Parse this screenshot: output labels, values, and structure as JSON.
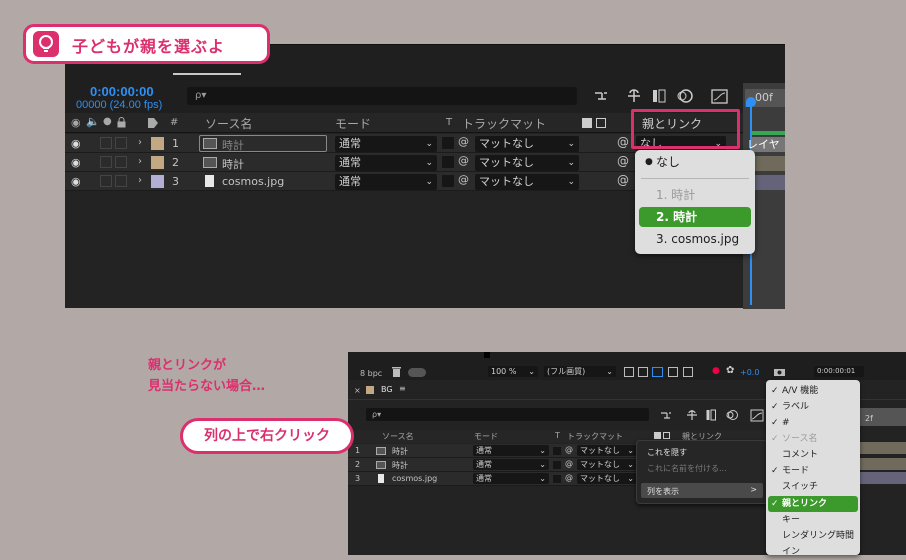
{
  "badge": {
    "title": "子どもが親を選ぶよ",
    "icon": "lightbulb-icon"
  },
  "top": {
    "timecode": "0:00:00:00",
    "fps": "00000 (24.00 fps)",
    "search_placeholder": "ρ▾",
    "timeline_label": "00f",
    "headers": {
      "hash": "#",
      "source": "ソース名",
      "mode": "モード",
      "t": "T",
      "matte": "トラックマット",
      "parent": "親とリンク"
    },
    "parent_value": "なし",
    "layer_label_right": "レイヤー",
    "rows": [
      {
        "num": "1",
        "name": "時計",
        "mode": "通常",
        "matte": "マットなし",
        "color": "#c2a983",
        "kind": "comp"
      },
      {
        "num": "2",
        "name": "時計",
        "mode": "通常",
        "matte": "マットなし",
        "color": "#c2a983",
        "kind": "comp"
      },
      {
        "num": "3",
        "name": "cosmos.jpg",
        "mode": "通常",
        "matte": "マットなし",
        "color": "#b3aed4",
        "kind": "file"
      }
    ],
    "dropdown": [
      {
        "label": "なし",
        "bullet": "●"
      },
      {
        "label": "1. 時計"
      },
      {
        "label": "2. 時計"
      },
      {
        "label": "3. cosmos.jpg"
      }
    ]
  },
  "notes": {
    "line1": "親とリンクが",
    "line2": "見当たらない場合…",
    "callout": "列の上で右クリック"
  },
  "bottom": {
    "bpc": "8 bpc",
    "zoom": "100 %",
    "quality": "(フル画質)",
    "exposure": "+0.0",
    "timecode": "0:00:00:01",
    "tab": "BG",
    "tab_menu": "≡",
    "timeline_label": "2f",
    "headers": {
      "source": "ソース名",
      "mode": "モード",
      "t": "T",
      "matte": "トラックマット",
      "parent": "親とリンク"
    },
    "rows": [
      {
        "num": "1",
        "name": "時計",
        "mode": "通常",
        "matte": "マットなし",
        "kind": "comp"
      },
      {
        "num": "2",
        "name": "時計",
        "mode": "通常",
        "matte": "マットなし",
        "kind": "comp"
      },
      {
        "num": "3",
        "name": "cosmos.jpg",
        "mode": "通常",
        "matte": "マットなし",
        "kind": "file"
      }
    ],
    "context_menu": [
      "これを隠す",
      "これに名前を付ける...",
      "列を表示"
    ],
    "context_arrow": ">",
    "columns_menu": [
      {
        "label": "A/V 機能",
        "checked": true
      },
      {
        "label": "ラベル",
        "checked": true
      },
      {
        "label": "#",
        "checked": true
      },
      {
        "label": "ソース名",
        "checked": true,
        "disabled": true
      },
      {
        "label": "コメント",
        "checked": false
      },
      {
        "label": "モード",
        "checked": true
      },
      {
        "label": "スイッチ",
        "checked": false
      },
      {
        "label": "親とリンク",
        "checked": true,
        "active": true
      },
      {
        "label": "キー",
        "checked": false
      },
      {
        "label": "レンダリング時間",
        "checked": false
      },
      {
        "label": "イン",
        "checked": false
      }
    ]
  },
  "colors": {
    "accent": "#dc2f6e",
    "timecode_blue": "#2f8ff2",
    "selected_green": "#3c9a2d",
    "background": "#b2a9a6"
  }
}
